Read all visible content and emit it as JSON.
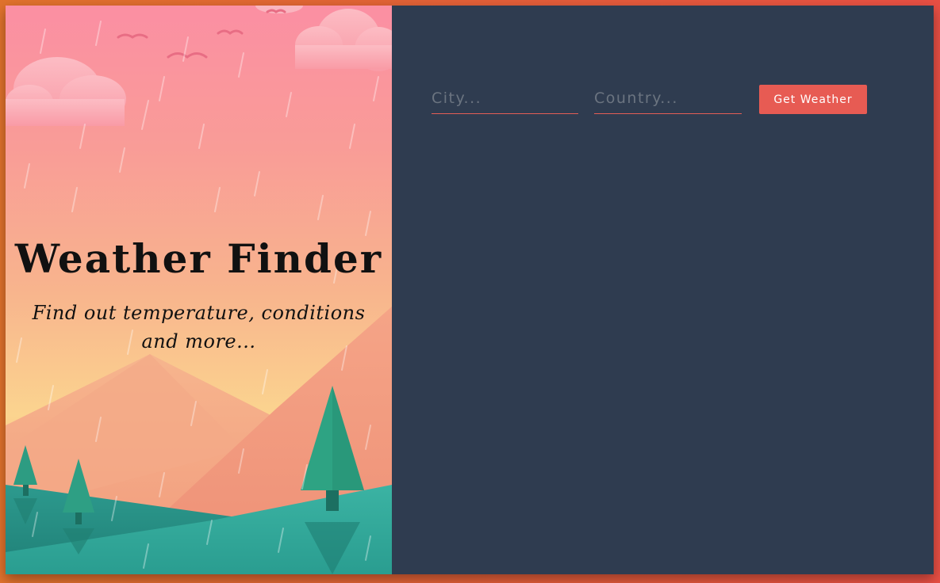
{
  "hero": {
    "title": "Weather Finder",
    "subtitle": "Find out temperature, conditions and more..."
  },
  "form": {
    "city_placeholder": "City...",
    "country_placeholder": "Country...",
    "city_value": "",
    "country_value": "",
    "submit_label": "Get Weather"
  },
  "colors": {
    "accent": "#e75b53",
    "panel_bg": "#2f3c50",
    "page_bg": "#e0722c"
  }
}
